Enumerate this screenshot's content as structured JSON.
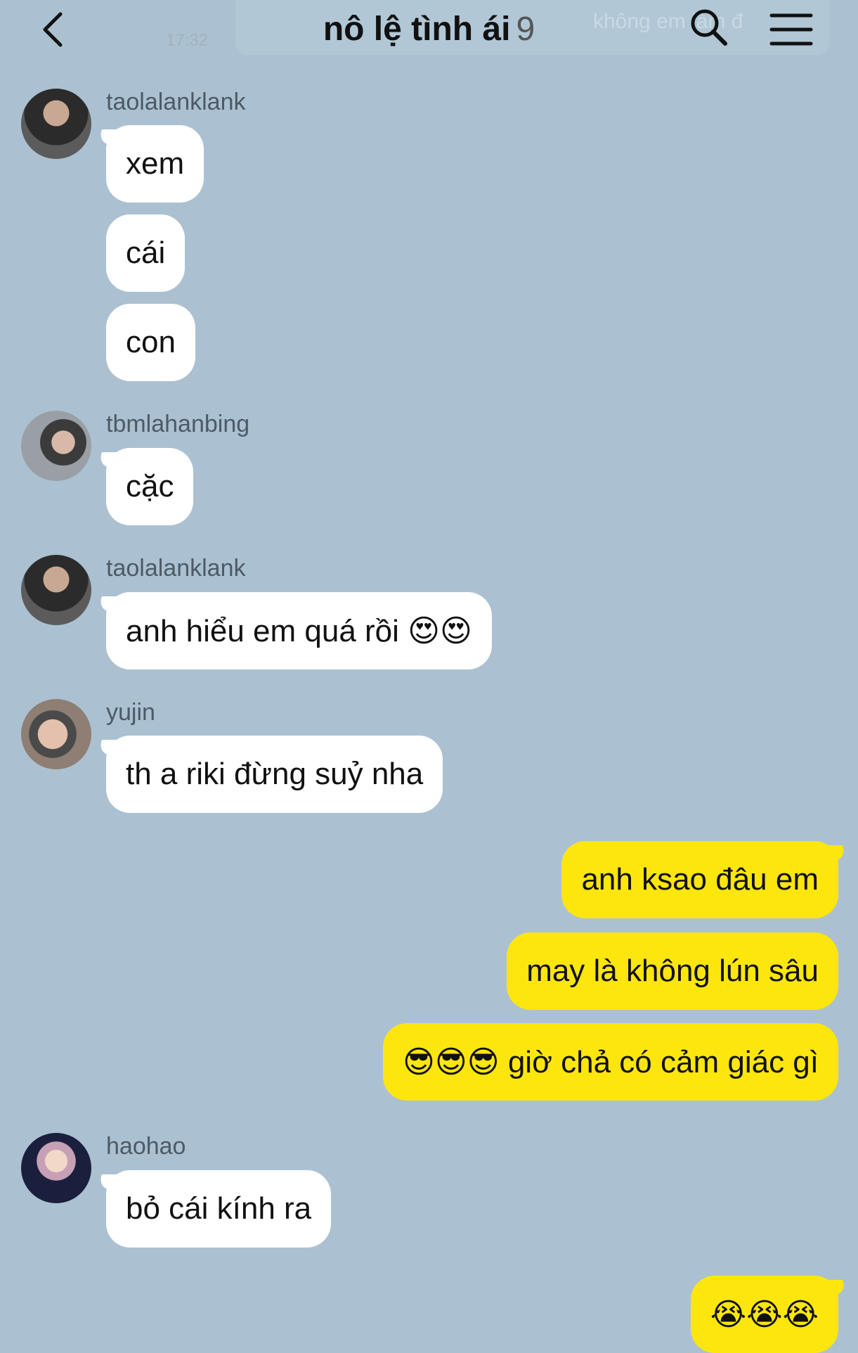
{
  "header": {
    "title": "nô lệ tình ái",
    "member_count": "9",
    "ghost_time": "17:32",
    "ghost_search": "không em làm đ"
  },
  "colors": {
    "background": "#abc1d1",
    "incoming_bubble": "#ffffff",
    "outgoing_bubble": "#fde60d"
  },
  "messages": [
    {
      "sender": "taolalanklank",
      "text": "xem"
    },
    {
      "text": "cái"
    },
    {
      "text": "con"
    },
    {
      "sender": "tbmlahanbing",
      "text": "cặc"
    },
    {
      "sender": "taolalanklank",
      "text": "anh hiểu em quá rồi 😍😍"
    },
    {
      "sender": "yujin",
      "text": "th a riki đừng suỷ nha"
    },
    {
      "text": "anh ksao đâu em"
    },
    {
      "text": "may là không lún sâu"
    },
    {
      "text": "😎😎😎 giờ chả có cảm giác gì"
    },
    {
      "sender": "haohao",
      "text": "bỏ cái kính ra"
    },
    {
      "text": "😭😭😭"
    }
  ]
}
